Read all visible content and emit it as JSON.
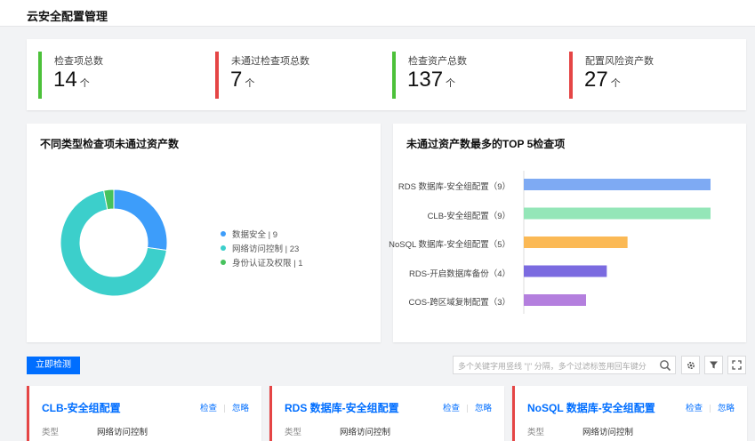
{
  "page": {
    "title": "云安全配置管理"
  },
  "stats": [
    {
      "label": "检查项总数",
      "value": "14",
      "unit": "个",
      "color": "#4cc13a"
    },
    {
      "label": "未通过检查项总数",
      "value": "7",
      "unit": "个",
      "color": "#e54545"
    },
    {
      "label": "检查资产总数",
      "value": "137",
      "unit": "个",
      "color": "#4cc13a"
    },
    {
      "label": "配置风险资产数",
      "value": "27",
      "unit": "个",
      "color": "#e54545"
    }
  ],
  "donut_panel": {
    "title": "不同类型检查项未通过资产数",
    "legend": [
      "数据安全 | 9",
      "网络访问控制 | 23",
      "身份认证及权限 | 1"
    ]
  },
  "bar_panel": {
    "title": "未通过资产数最多的TOP 5检查项"
  },
  "chart_data": [
    {
      "type": "pie",
      "categories": [
        "数据安全",
        "网络访问控制",
        "身份认证及权限"
      ],
      "values": [
        9,
        23,
        1
      ],
      "colors": [
        "#3d9dfa",
        "#3ccfcb",
        "#46c25d"
      ],
      "title": "不同类型检查项未通过资产数",
      "legend": "right"
    },
    {
      "type": "bar",
      "orientation": "horizontal",
      "categories": [
        "RDS 数据库-安全组配置（9）",
        "CLB-安全组配置（9）",
        "NoSQL 数据库-安全组配置（5）",
        "RDS-开启数据库备份（4）",
        "COS-跨区域复制配置（3）"
      ],
      "values": [
        9,
        9,
        5,
        4,
        3
      ],
      "colors": [
        "#7eaaf3",
        "#94e6b8",
        "#fbb955",
        "#7b6be0",
        "#b47fde"
      ],
      "title": "未通过资产数最多的TOP 5检查项"
    }
  ],
  "toolbar": {
    "detect_label": "立即检测",
    "search_placeholder": "多个关键字用竖线 \"|\" 分隔，多个过滤标签用回车键分",
    "icons": [
      "search-icon",
      "gear-icon",
      "filter-icon",
      "fullscreen-icon"
    ]
  },
  "cards": [
    {
      "title": "CLB-安全组配置",
      "check": "检查",
      "ignore": "忽略",
      "type_label": "类型",
      "type_value": "网络访问控制"
    },
    {
      "title": "RDS 数据库-安全组配置",
      "check": "检查",
      "ignore": "忽略",
      "type_label": "类型",
      "type_value": "网络访问控制"
    },
    {
      "title": "NoSQL 数据库-安全组配置",
      "check": "检查",
      "ignore": "忽略",
      "type_label": "类型",
      "type_value": "网络访问控制"
    }
  ]
}
